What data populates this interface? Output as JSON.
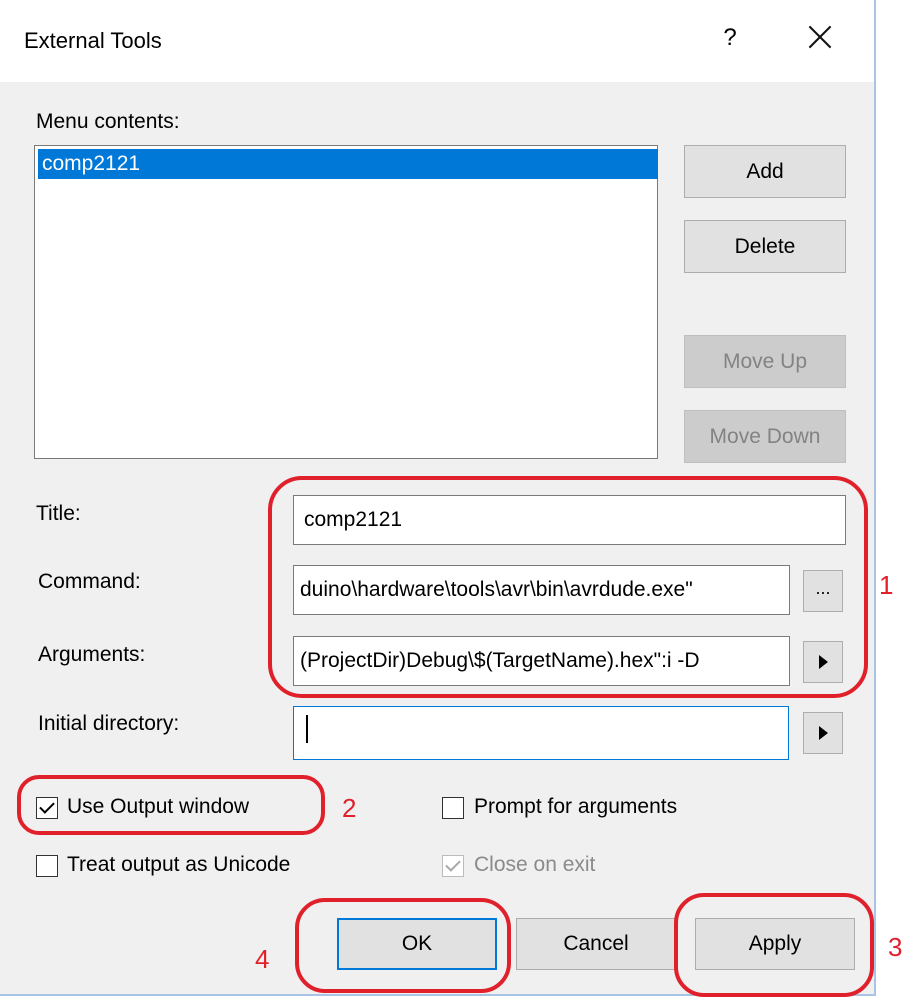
{
  "window": {
    "title": "External Tools",
    "help_label": "?"
  },
  "menu": {
    "label": "Menu contents:",
    "items": [
      "comp2121"
    ]
  },
  "buttons": {
    "add": "Add",
    "delete": "Delete",
    "move_up": "Move Up",
    "move_down": "Move Down",
    "ok": "OK",
    "cancel": "Cancel",
    "apply": "Apply"
  },
  "fields": {
    "title_label": "Title:",
    "title_value": "comp2121",
    "command_label": "Command:",
    "command_value": "duino\\hardware\\tools\\avr\\bin\\avrdude.exe\"",
    "command_browse": "...",
    "arguments_label": "Arguments:",
    "arguments_value": "(ProjectDir)Debug\\$(TargetName).hex\":i -D",
    "initial_directory_label": "Initial directory:",
    "initial_directory_value": ""
  },
  "options": {
    "use_output_window": "Use Output window",
    "prompt_for_arguments": "Prompt for arguments",
    "treat_output_as_unicode": "Treat output as Unicode",
    "close_on_exit": "Close on exit"
  },
  "annotations": {
    "one": "1",
    "two": "2",
    "three": "3",
    "four": "4"
  },
  "colors": {
    "selection": "#0078d7",
    "annotation": "#e0202a"
  },
  "icons": {
    "close": "close-icon",
    "arrow": "arrow-right-icon",
    "check": "check-icon"
  }
}
